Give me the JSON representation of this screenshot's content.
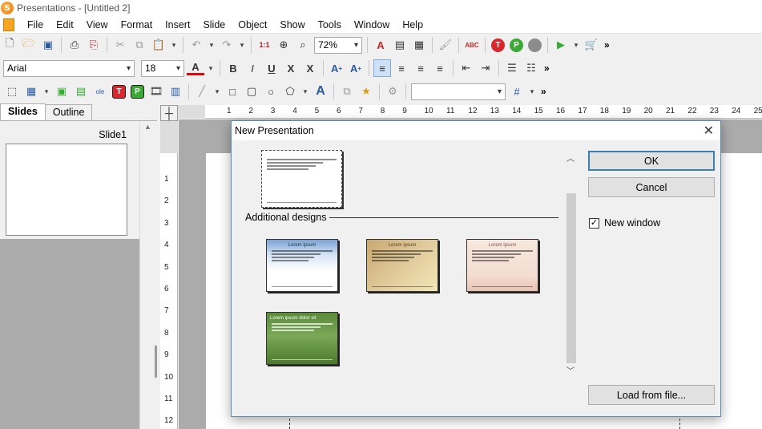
{
  "window": {
    "title": "Presentations - [Untitled 2]",
    "app_icon_letter": "S"
  },
  "menu": [
    "File",
    "Edit",
    "View",
    "Format",
    "Insert",
    "Slide",
    "Object",
    "Show",
    "Tools",
    "Window",
    "Help"
  ],
  "toolbar": {
    "zoom": "72%",
    "font_name": "Arial",
    "font_size": "18",
    "icons1": [
      "new-icon",
      "open-icon",
      "save-icon",
      "print-icon",
      "pdf-icon",
      "cut-icon",
      "copy-icon",
      "paste-icon",
      "undo-icon",
      "redo-icon",
      "insert-table-icon",
      "zoom-magnifier-icon",
      "find-icon"
    ],
    "circle_buttons": [
      {
        "letter": "T",
        "color": "#d9272e"
      },
      {
        "letter": "P",
        "color": "#3aa935"
      },
      {
        "letter": "",
        "color": "#8c8c8c"
      }
    ],
    "square_buttons": [
      {
        "letter": "T",
        "color": "#d9272e"
      },
      {
        "letter": "P",
        "color": "#3aa935"
      }
    ],
    "chevron": "»"
  },
  "left_panel": {
    "tabs": [
      "Slides",
      "Outline"
    ],
    "slide_label": "Slide1"
  },
  "ruler": {
    "h": [
      "1",
      "2",
      "3",
      "4",
      "5",
      "6",
      "7",
      "8",
      "9",
      "10",
      "11",
      "12",
      "13",
      "14",
      "15",
      "16",
      "17",
      "18",
      "19",
      "20",
      "21",
      "22",
      "23",
      "24",
      "25"
    ],
    "v": [
      "1",
      "2",
      "3",
      "4",
      "5",
      "6",
      "7",
      "8",
      "9",
      "10",
      "11",
      "12"
    ]
  },
  "dialog": {
    "title": "New Presentation",
    "section_label": "Additional designs",
    "template_title": "Lorem ipsum",
    "green_title": "Lorem ipsum dolor sit",
    "ok_label": "OK",
    "cancel_label": "Cancel",
    "new_window_label": "New window",
    "new_window_checked": true,
    "check_mark": "✓",
    "load_label": "Load from file..."
  }
}
